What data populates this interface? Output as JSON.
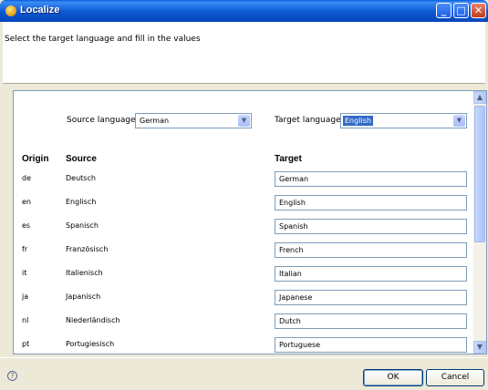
{
  "window": {
    "title": "Localize"
  },
  "header": {
    "description": "Select the target language and fill in the values"
  },
  "selectors": {
    "source_label": "Source language:",
    "source_value": "German",
    "target_label": "Target language:",
    "target_value": "English"
  },
  "table": {
    "headers": {
      "origin": "Origin",
      "source": "Source",
      "target": "Target"
    },
    "rows": [
      {
        "origin": "de",
        "source": "Deutsch",
        "target": "German"
      },
      {
        "origin": "en",
        "source": "Englisch",
        "target": "English"
      },
      {
        "origin": "es",
        "source": "Spanisch",
        "target": "Spanish"
      },
      {
        "origin": "fr",
        "source": "Französisch",
        "target": "French"
      },
      {
        "origin": "it",
        "source": "Italienisch",
        "target": "Italian"
      },
      {
        "origin": "ja",
        "source": "Japanisch",
        "target": "Japanese"
      },
      {
        "origin": "nl",
        "source": "Niederländisch",
        "target": "Dutch"
      },
      {
        "origin": "pt",
        "source": "Portugiesisch",
        "target": "Portuguese"
      }
    ]
  },
  "buttons": {
    "ok": "OK",
    "cancel": "Cancel"
  },
  "icons": {
    "app": "localize-app-icon",
    "help": "help-icon",
    "minimize": "minimize-icon",
    "maximize": "maximize-icon",
    "close": "close-icon"
  },
  "colors": {
    "titlebar": "#0b58d2",
    "selection": "#316ac5",
    "dialog_bg": "#ece9d8"
  }
}
